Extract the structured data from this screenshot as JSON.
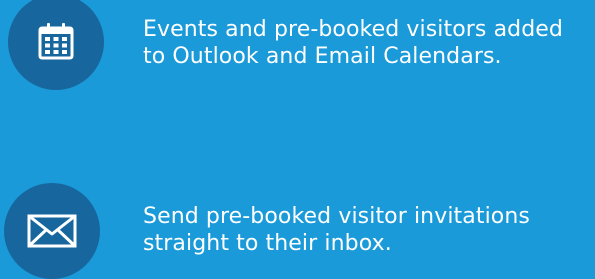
{
  "features": [
    {
      "icon": "calendar-icon",
      "line1": "Events and pre-booked visitors added",
      "line2": "to Outlook and Email Calendars."
    },
    {
      "icon": "envelope-icon",
      "line1": "Send pre-booked visitor invitations",
      "line2": "straight to their inbox."
    }
  ],
  "colors": {
    "background": "#1a9ad9",
    "icon_circle": "#17679e",
    "text": "#ffffff"
  }
}
